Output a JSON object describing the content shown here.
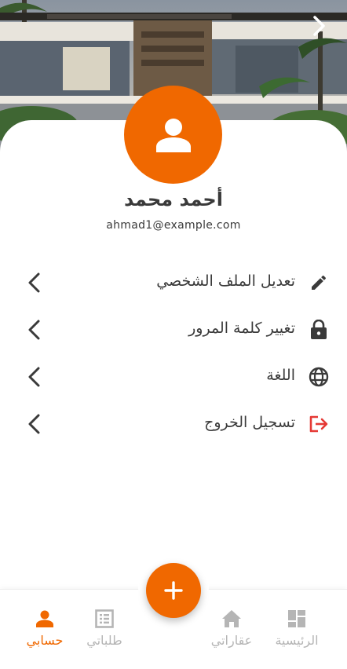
{
  "header": {
    "back_icon": "chevron-right-icon"
  },
  "profile": {
    "name": "أحمد محمد",
    "email": "ahmad1@example.com",
    "avatar_icon": "person-icon"
  },
  "menu": [
    {
      "label": "تعديل الملف الشخصي",
      "icon": "pencil-icon"
    },
    {
      "label": "تغيير كلمة المرور",
      "icon": "lock-icon"
    },
    {
      "label": "اللغة",
      "icon": "globe-icon"
    },
    {
      "label": "تسجيل الخروج",
      "icon": "logout-icon"
    }
  ],
  "bottom_nav": {
    "items": [
      {
        "label": "الرئيسية",
        "icon": "dashboard-icon",
        "active": false
      },
      {
        "label": "عقاراتي",
        "icon": "home-icon",
        "active": false
      },
      {
        "label": "طلباتي",
        "icon": "list-icon",
        "active": false
      },
      {
        "label": "حسابي",
        "icon": "person-icon",
        "active": true
      }
    ],
    "fab_icon": "plus-icon"
  },
  "colors": {
    "accent": "#f06800",
    "logout": "#e53935",
    "text": "#3a3a3a",
    "inactive": "#b5b5b5"
  }
}
